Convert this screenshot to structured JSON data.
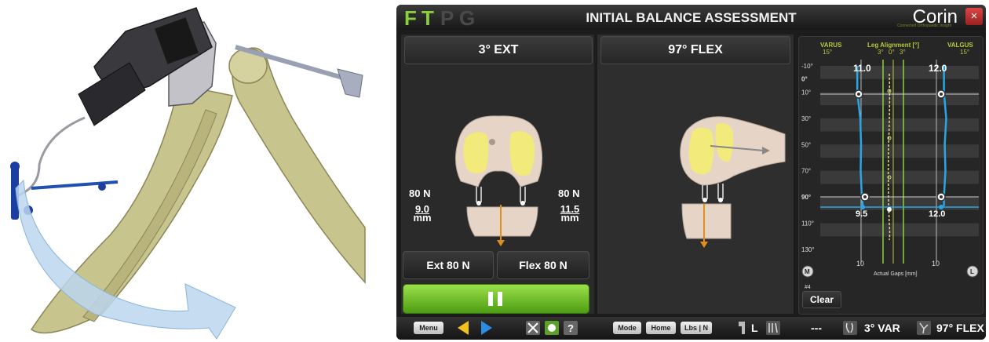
{
  "window": {
    "logo": [
      "F",
      "T",
      "P",
      "G"
    ],
    "title": "INITIAL BALANCE ASSESSMENT",
    "brand": "Corin",
    "brand_tagline": "Connected Orthopaedic Insight",
    "close_symbol": "×"
  },
  "left_panel": {
    "header": "3° EXT",
    "medial_force": "80 N",
    "lateral_force": "80 N",
    "medial_gap_value": "9.0",
    "lateral_gap_value": "11.5",
    "gap_unit": "mm",
    "ext_button": "Ext 80 N",
    "flex_button": "Flex 80 N",
    "play_state": "paused"
  },
  "center_panel": {
    "header": "97° FLEX"
  },
  "chart": {
    "varus_label": "VARUS",
    "varus_value": "15°",
    "alignment_label": "Leg Alignment [°]",
    "alignment_ticks": [
      "3°",
      "0°",
      "3°"
    ],
    "valgus_label": "VALGUS",
    "valgus_value": "15°",
    "left_top_value": "11.0",
    "right_top_value": "12.0",
    "left_bottom_value": "9.5",
    "right_bottom_value": "12.0",
    "x_tick_left": "10",
    "x_tick_right": "10",
    "x_label": "Actual Gaps [mm]",
    "medial_marker": "M",
    "lateral_marker": "L",
    "record_id": "#4",
    "clear_button": "Clear"
  },
  "chart_data": {
    "type": "line",
    "y_axis_label": "",
    "y_ticks": [
      "-10°",
      "0°",
      "10°",
      "30°",
      "50°",
      "70°",
      "90°",
      "110°",
      "130°"
    ],
    "ylim": [
      -10,
      130
    ],
    "series": [
      {
        "side": "medial",
        "points": [
          [
            11.0,
            -10
          ],
          [
            11.0,
            10
          ],
          [
            10.2,
            30
          ],
          [
            10.0,
            50
          ],
          [
            10.1,
            70
          ],
          [
            9.8,
            90
          ],
          [
            9.5,
            97
          ]
        ]
      },
      {
        "side": "lateral",
        "points": [
          [
            12.0,
            -10
          ],
          [
            12.0,
            10
          ],
          [
            12.6,
            30
          ],
          [
            12.2,
            50
          ],
          [
            12.4,
            70
          ],
          [
            12.0,
            90
          ],
          [
            12.0,
            97
          ]
        ]
      }
    ]
  },
  "toolbar": {
    "menu": "Menu",
    "mode": "Mode",
    "home": "Home",
    "units": "Lbs | N",
    "side": "L",
    "placeholder": "---",
    "varus_reading": "3° VAR",
    "flex_reading": "97° FLEX"
  },
  "colors": {
    "accent_green": "#8ccf3c",
    "curve_blue": "#2aa6e6",
    "gold_guide": "#b8c840",
    "bone": "#e8d6c8",
    "contact": "#f2ea7a"
  }
}
